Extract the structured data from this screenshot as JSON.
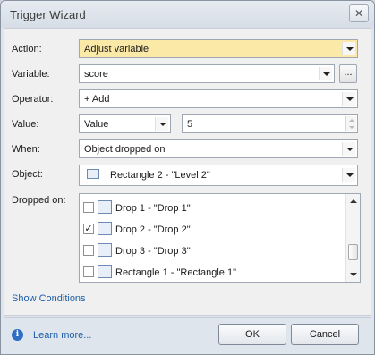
{
  "window": {
    "title": "Trigger Wizard",
    "close_glyph": "✕"
  },
  "form": {
    "action": {
      "label": "Action:",
      "value": "Adjust variable"
    },
    "variable": {
      "label": "Variable:",
      "value": "score",
      "browse_label": "..."
    },
    "operator": {
      "label": "Operator:",
      "value": "+ Add"
    },
    "value": {
      "label": "Value:",
      "type": "Value",
      "number": "5"
    },
    "when": {
      "label": "When:",
      "value": "Object dropped on"
    },
    "object": {
      "label": "Object:",
      "value": "Rectangle 2 - \"Level 2\""
    },
    "dropped_on": {
      "label": "Dropped on:",
      "items": [
        {
          "label": "Drop 1 - \"Drop 1\"",
          "checked": false
        },
        {
          "label": "Drop 2 - \"Drop 2\"",
          "checked": true
        },
        {
          "label": "Drop 3 - \"Drop 3\"",
          "checked": false
        },
        {
          "label": "Rectangle 1 - \"Rectangle 1\"",
          "checked": false
        }
      ]
    }
  },
  "links": {
    "show_conditions": "Show Conditions",
    "learn_more": "Learn more..."
  },
  "buttons": {
    "ok": "OK",
    "cancel": "Cancel"
  },
  "icons": {
    "info": "info-icon",
    "checkmark": "✓"
  }
}
